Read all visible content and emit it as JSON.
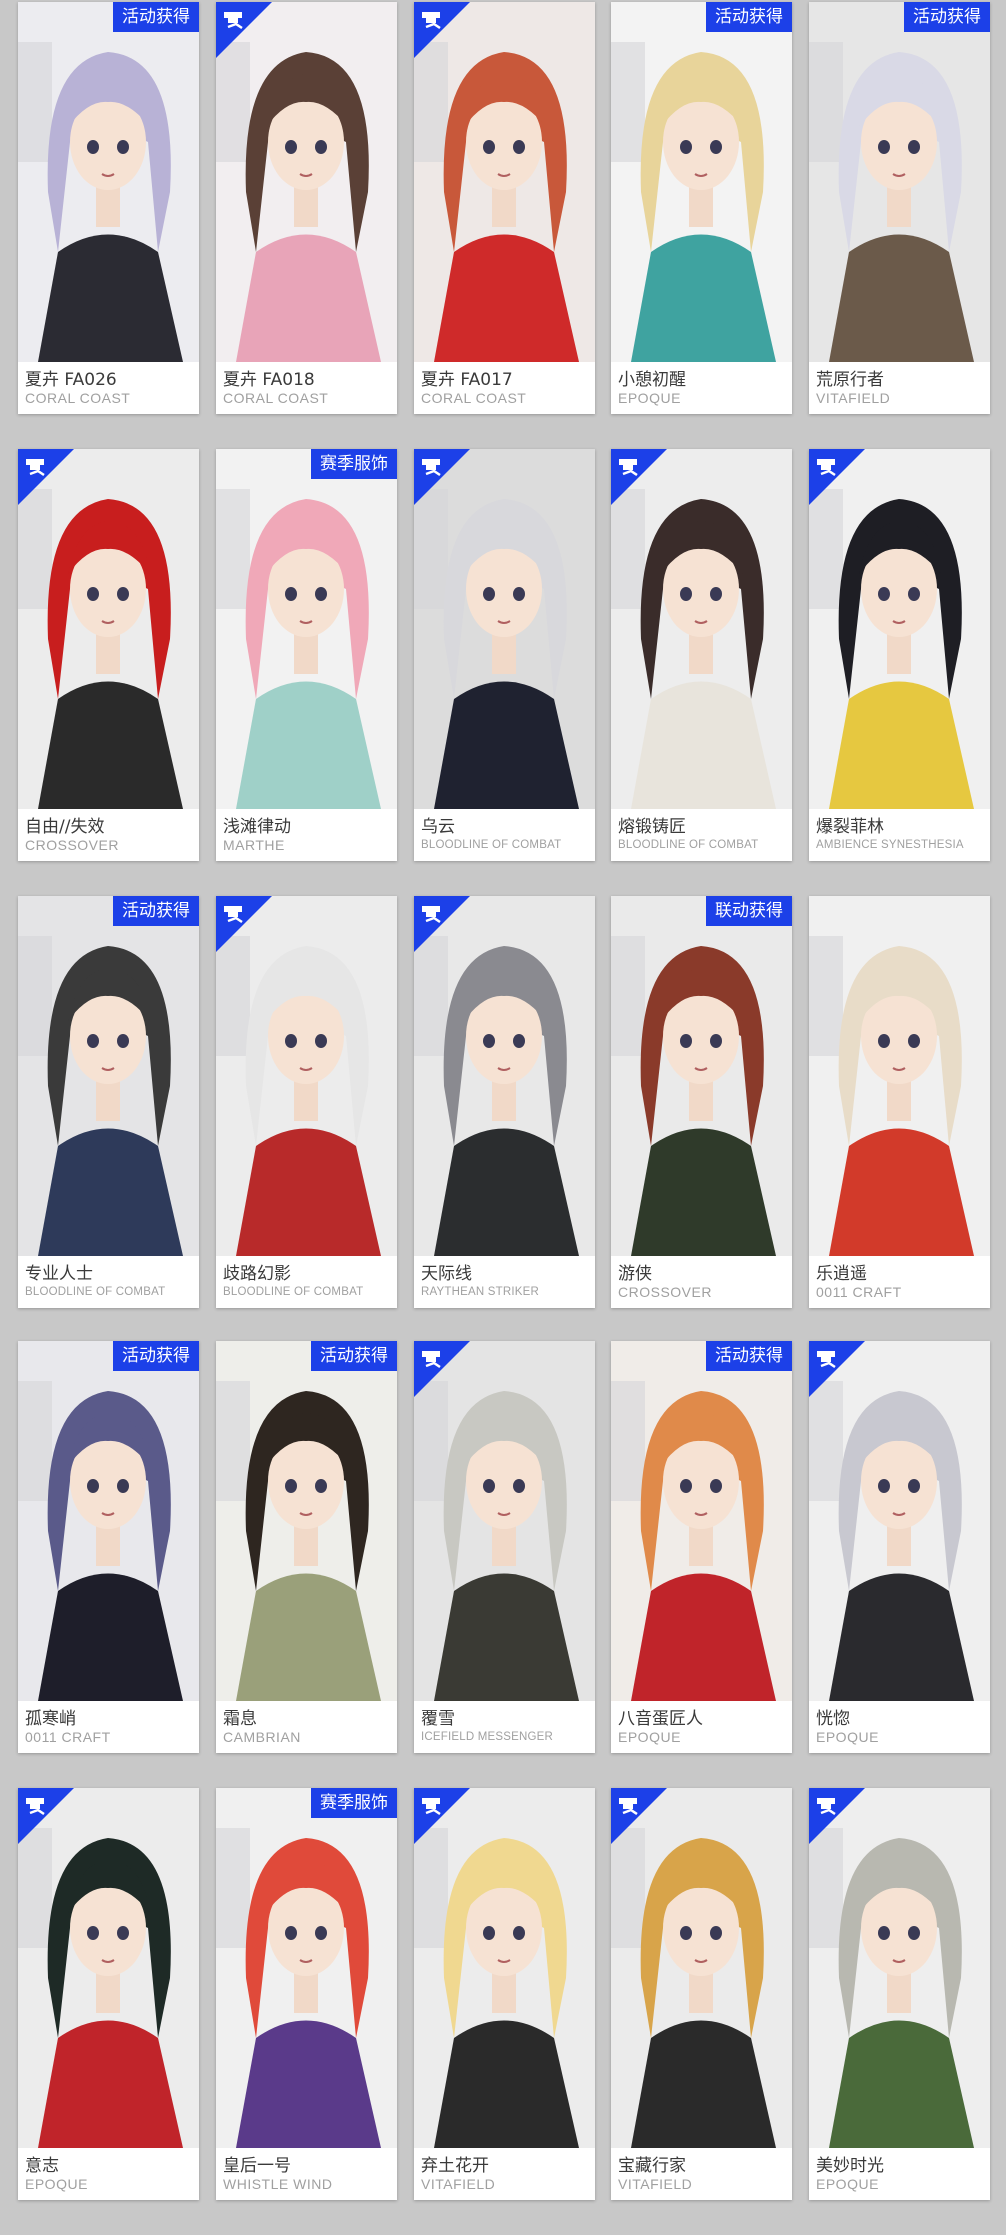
{
  "cards": [
    {
      "name": "夏卉 FA026",
      "brand": "CORAL COAST",
      "badge": "活动获得",
      "corner": false,
      "hair": "#b8b2d6",
      "accent": "#2b2b33",
      "bg": "#ececf0"
    },
    {
      "name": "夏卉 FA018",
      "brand": "CORAL COAST",
      "badge": "",
      "corner": true,
      "hair": "#5a4036",
      "accent": "#e8a4b8",
      "bg": "#f2eef0"
    },
    {
      "name": "夏卉 FA017",
      "brand": "CORAL COAST",
      "badge": "",
      "corner": true,
      "hair": "#c8583a",
      "accent": "#cf2a2a",
      "bg": "#eee8e6"
    },
    {
      "name": "小憩初醒",
      "brand": "EPOQUE",
      "badge": "活动获得",
      "corner": false,
      "hair": "#e8d49a",
      "accent": "#3fa3a0",
      "bg": "#f3f3f3"
    },
    {
      "name": "荒原行者",
      "brand": "VITAFIELD",
      "badge": "活动获得",
      "corner": false,
      "hair": "#d9d9e6",
      "accent": "#6b5a4a",
      "bg": "#e6e6e6"
    },
    {
      "name": "自由//失效",
      "brand": "CROSSOVER",
      "badge": "",
      "corner": true,
      "hair": "#c81e1e",
      "accent": "#2a2a2a",
      "bg": "#ececec"
    },
    {
      "name": "浅滩律动",
      "brand": "MARTHE",
      "badge": "赛季服饰",
      "corner": false,
      "hair": "#f0a8b8",
      "accent": "#9fd0c8",
      "bg": "#f2f2f2"
    },
    {
      "name": "乌云",
      "brand": "BLOODLINE OF COMBAT",
      "badge": "",
      "corner": true,
      "hair": "#d8d8dc",
      "accent": "#1f2230",
      "bg": "#dcdcdc"
    },
    {
      "name": "熔锻铸匠",
      "brand": "BLOODLINE OF COMBAT",
      "badge": "",
      "corner": true,
      "hair": "#3a2c2a",
      "accent": "#e8e4dc",
      "bg": "#ededed"
    },
    {
      "name": "爆裂菲林",
      "brand": "AMBIENCE SYNESTHESIA",
      "badge": "",
      "corner": true,
      "hair": "#1e1e24",
      "accent": "#e6c840",
      "bg": "#f0f0f0"
    },
    {
      "name": "专业人士",
      "brand": "BLOODLINE OF COMBAT",
      "badge": "活动获得",
      "corner": false,
      "hair": "#3a3a3a",
      "accent": "#2e3a5a",
      "bg": "#e4e4e6"
    },
    {
      "name": "歧路幻影",
      "brand": "BLOODLINE OF COMBAT",
      "badge": "",
      "corner": true,
      "hair": "#e6e6e6",
      "accent": "#b82a2a",
      "bg": "#ececec"
    },
    {
      "name": "天际线",
      "brand": "RAYTHEAN STRIKER",
      "badge": "",
      "corner": true,
      "hair": "#8a8a90",
      "accent": "#2b2d2f",
      "bg": "#e8e8e8"
    },
    {
      "name": "游侠",
      "brand": "CROSSOVER",
      "badge": "联动获得",
      "corner": false,
      "hair": "#8a3a2a",
      "accent": "#2f3a2a",
      "bg": "#eaeaea"
    },
    {
      "name": "乐逍遥",
      "brand": "0011 CRAFT",
      "badge": "",
      "corner": false,
      "hair": "#e8dcc8",
      "accent": "#d23a2a",
      "bg": "#f0f0f0"
    },
    {
      "name": "孤寒峭",
      "brand": "0011 CRAFT",
      "badge": "活动获得",
      "corner": false,
      "hair": "#5a5a8a",
      "accent": "#1e1e2a",
      "bg": "#e8e8ec"
    },
    {
      "name": "霜息",
      "brand": "CAMBRIAN",
      "badge": "活动获得",
      "corner": false,
      "hair": "#2e2620",
      "accent": "#9aa07a",
      "bg": "#eeeeea"
    },
    {
      "name": "覆雪",
      "brand": "ICEFIELD MESSENGER",
      "badge": "",
      "corner": true,
      "hair": "#c8c8c2",
      "accent": "#3a3a34",
      "bg": "#e4e4e4"
    },
    {
      "name": "八音蛋匠人",
      "brand": "EPOQUE",
      "badge": "活动获得",
      "corner": false,
      "hair": "#e08a4a",
      "accent": "#c0242a",
      "bg": "#f0ece8"
    },
    {
      "name": "恍惚",
      "brand": "EPOQUE",
      "badge": "",
      "corner": true,
      "hair": "#c8c8d0",
      "accent": "#2a2a2e",
      "bg": "#efefef"
    },
    {
      "name": "意志",
      "brand": "EPOQUE",
      "badge": "",
      "corner": true,
      "hair": "#1e2a26",
      "accent": "#c0242a",
      "bg": "#ececec"
    },
    {
      "name": "皇后一号",
      "brand": "WHISTLE WIND",
      "badge": "赛季服饰",
      "corner": false,
      "hair": "#e04a3a",
      "accent": "#5a3a8a",
      "bg": "#f0f0f0"
    },
    {
      "name": "弃土花开",
      "brand": "VITAFIELD",
      "badge": "",
      "corner": true,
      "hair": "#f0d890",
      "accent": "#2a2a2a",
      "bg": "#ececec"
    },
    {
      "name": "宝藏行家",
      "brand": "VITAFIELD",
      "badge": "",
      "corner": true,
      "hair": "#d8a44a",
      "accent": "#2a2a2a",
      "bg": "#ebebeb"
    },
    {
      "name": "美妙时光",
      "brand": "EPOQUE",
      "badge": "",
      "corner": true,
      "hair": "#b8b8b0",
      "accent": "#4a6a3a",
      "bg": "#eeeeee"
    }
  ]
}
